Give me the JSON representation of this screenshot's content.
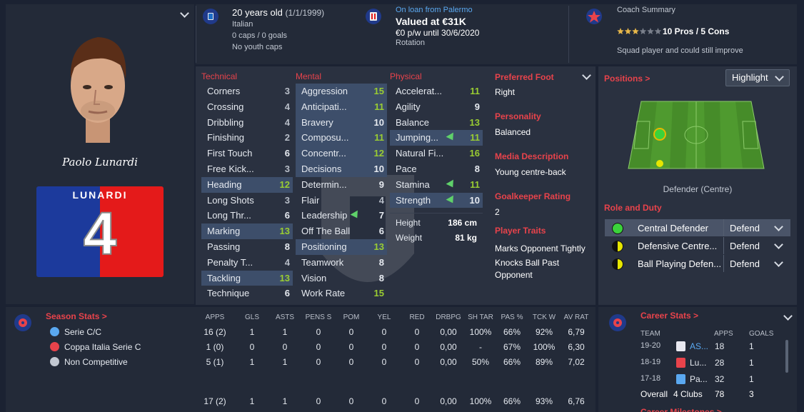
{
  "player": {
    "name_shirt": "LUNARDI",
    "number": "4",
    "signature": "Paolo Lunardi",
    "age": "20 years old",
    "dob": "(1/1/1999)",
    "nationality": "Italian",
    "caps": "0 caps / 0 goals",
    "youth_caps": "No youth caps"
  },
  "contract": {
    "loan": "On loan from Palermo",
    "value": "Valued at €31K",
    "wage": "€0 p/w until 30/6/2020",
    "status": "Rotation"
  },
  "coach": {
    "title": "Coach Summary",
    "stars": 3,
    "stars_max": 6,
    "pros_cons": "10 Pros / 5 Cons",
    "summary": "Squad player and could still improve"
  },
  "technical": {
    "title": "Technical",
    "rows": [
      {
        "name": "Corners",
        "value": "3",
        "hl": false,
        "style": "d"
      },
      {
        "name": "Crossing",
        "value": "4",
        "hl": false,
        "style": "d"
      },
      {
        "name": "Dribbling",
        "value": "4",
        "hl": false,
        "style": "d"
      },
      {
        "name": "Finishing",
        "value": "2",
        "hl": false,
        "style": "d"
      },
      {
        "name": "First Touch",
        "value": "6",
        "hl": false,
        "style": "w"
      },
      {
        "name": "Free Kick...",
        "value": "3",
        "hl": false,
        "style": "d"
      },
      {
        "name": "Heading",
        "value": "12",
        "hl": true,
        "style": "g"
      },
      {
        "name": "Long Shots",
        "value": "3",
        "hl": false,
        "style": "d"
      },
      {
        "name": "Long Thr...",
        "value": "6",
        "hl": false,
        "style": "w"
      },
      {
        "name": "Marking",
        "value": "13",
        "hl": true,
        "style": "g"
      },
      {
        "name": "Passing",
        "value": "8",
        "hl": false,
        "style": "w"
      },
      {
        "name": "Penalty T...",
        "value": "4",
        "hl": false,
        "style": "d"
      },
      {
        "name": "Tackling",
        "value": "13",
        "hl": true,
        "style": "g"
      },
      {
        "name": "Technique",
        "value": "6",
        "hl": false,
        "style": "w"
      }
    ]
  },
  "mental": {
    "title": "Mental",
    "rows": [
      {
        "name": "Aggression",
        "value": "15",
        "hl": true,
        "style": "g",
        "up": false
      },
      {
        "name": "Anticipati...",
        "value": "11",
        "hl": true,
        "style": "g",
        "up": false
      },
      {
        "name": "Bravery",
        "value": "10",
        "hl": true,
        "style": "w",
        "up": false
      },
      {
        "name": "Composu...",
        "value": "11",
        "hl": true,
        "style": "g",
        "up": false
      },
      {
        "name": "Concentr...",
        "value": "12",
        "hl": true,
        "style": "g",
        "up": false
      },
      {
        "name": "Decisions",
        "value": "10",
        "hl": true,
        "style": "w",
        "up": false
      },
      {
        "name": "Determin...",
        "value": "9",
        "hl": false,
        "style": "w",
        "up": false
      },
      {
        "name": "Flair",
        "value": "4",
        "hl": false,
        "style": "d",
        "up": false
      },
      {
        "name": "Leadership",
        "value": "7",
        "hl": false,
        "style": "w",
        "up": true
      },
      {
        "name": "Off The Ball",
        "value": "6",
        "hl": false,
        "style": "w",
        "up": false
      },
      {
        "name": "Positioning",
        "value": "13",
        "hl": true,
        "style": "g",
        "up": false
      },
      {
        "name": "Teamwork",
        "value": "8",
        "hl": false,
        "style": "w",
        "up": false
      },
      {
        "name": "Vision",
        "value": "8",
        "hl": false,
        "style": "w",
        "up": false
      },
      {
        "name": "Work Rate",
        "value": "15",
        "hl": false,
        "style": "g",
        "up": false
      }
    ]
  },
  "physical": {
    "title": "Physical",
    "rows": [
      {
        "name": "Accelerat...",
        "value": "11",
        "hl": false,
        "style": "g",
        "up": false
      },
      {
        "name": "Agility",
        "value": "9",
        "hl": false,
        "style": "w",
        "up": false
      },
      {
        "name": "Balance",
        "value": "13",
        "hl": false,
        "style": "g",
        "up": false
      },
      {
        "name": "Jumping...",
        "value": "11",
        "hl": true,
        "style": "g",
        "up": true
      },
      {
        "name": "Natural Fi...",
        "value": "16",
        "hl": false,
        "style": "g",
        "up": false
      },
      {
        "name": "Pace",
        "value": "8",
        "hl": false,
        "style": "w",
        "up": false
      },
      {
        "name": "Stamina",
        "value": "11",
        "hl": false,
        "style": "g",
        "up": true
      },
      {
        "name": "Strength",
        "value": "10",
        "hl": true,
        "style": "w",
        "up": true
      }
    ],
    "height_label": "Height",
    "height": "186 cm",
    "weight_label": "Weight",
    "weight": "81 kg"
  },
  "info": {
    "foot_title": "Preferred Foot",
    "foot": "Right",
    "personality_title": "Personality",
    "personality": "Balanced",
    "media_title": "Media Description",
    "media": "Young centre-back",
    "gk_title": "Goalkeeper Rating",
    "gk": "2",
    "traits_title": "Player Traits",
    "traits": [
      "Marks Opponent Tightly",
      "Knocks Ball Past",
      "Opponent"
    ]
  },
  "positions": {
    "title": "Positions >",
    "highlight": "Highlight",
    "position_label": "Defender (Centre)"
  },
  "roles": {
    "title": "Role and Duty",
    "rows": [
      {
        "role": "Central Defender",
        "duty": "Defend",
        "status": "green"
      },
      {
        "role": "Defensive Centre...",
        "duty": "Defend",
        "status": "yellow"
      },
      {
        "role": "Ball Playing Defen...",
        "duty": "Defend",
        "status": "yellow"
      }
    ]
  },
  "season": {
    "title": "Season Stats >",
    "headers": [
      "APPS",
      "GLS",
      "ASTS",
      "PENS S",
      "POM",
      "YEL",
      "RED",
      "DRBPG",
      "SH TAR",
      "PAS %",
      "TCK W",
      "AV RAT"
    ],
    "rows": [
      {
        "comp": "Serie C/C",
        "cells": [
          "16 (2)",
          "1",
          "1",
          "0",
          "0",
          "0",
          "0",
          "0,00",
          "100%",
          "66%",
          "92%",
          "6,79"
        ]
      },
      {
        "comp": "Coppa Italia Serie C",
        "cells": [
          "1 (0)",
          "0",
          "0",
          "0",
          "0",
          "0",
          "0",
          "0,00",
          "-",
          "67%",
          "100%",
          "6,30"
        ]
      },
      {
        "comp": "Non Competitive",
        "cells": [
          "5 (1)",
          "1",
          "1",
          "0",
          "0",
          "0",
          "0",
          "0,00",
          "50%",
          "66%",
          "89%",
          "7,02"
        ]
      }
    ],
    "total": [
      "17 (2)",
      "1",
      "1",
      "0",
      "0",
      "0",
      "0",
      "0,00",
      "100%",
      "66%",
      "93%",
      "6,76"
    ]
  },
  "career": {
    "title": "Career Stats >",
    "headers": [
      "TEAM",
      "APPS",
      "GOALS"
    ],
    "rows": [
      {
        "season": "19-20",
        "team": "AS...",
        "apps": "18",
        "goals": "1"
      },
      {
        "season": "18-19",
        "team": "Lu...",
        "apps": "28",
        "goals": "1"
      },
      {
        "season": "17-18",
        "team": "Pa...",
        "apps": "32",
        "goals": "1"
      }
    ],
    "overall_label": "Overall",
    "overall_team": "4 Clubs",
    "overall_apps": "78",
    "overall_goals": "3",
    "milestones": "Career Milestones >"
  },
  "colors": {
    "accent": "#e8434b",
    "green": "#9acd32",
    "highlight": "#3d4e6a",
    "panel": "#2a3140"
  }
}
